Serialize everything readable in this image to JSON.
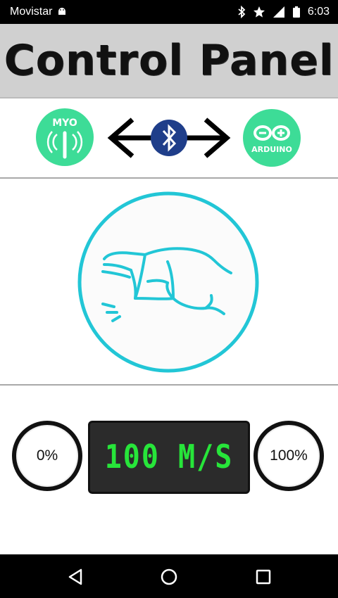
{
  "status_bar": {
    "carrier": "Movistar",
    "time": "6:03",
    "icons": [
      "android-icon",
      "bluetooth-icon",
      "star-icon",
      "signal-icon",
      "battery-icon"
    ]
  },
  "header": {
    "title": "Control Panel"
  },
  "connection": {
    "myo_label": "MYO",
    "arduino_label": "ARDUINO",
    "accent_color": "#3ddc97",
    "bluetooth_color": "#1f3e8a"
  },
  "gesture": {
    "icon": "pinch-hand-gesture",
    "color": "#22c6d6"
  },
  "speed": {
    "min_label": "0%",
    "max_label": "100%",
    "display_value": "100 M/S",
    "display_color": "#27e53a"
  },
  "nav_bar": {
    "icons": [
      "back-icon",
      "home-icon",
      "recents-icon"
    ]
  }
}
